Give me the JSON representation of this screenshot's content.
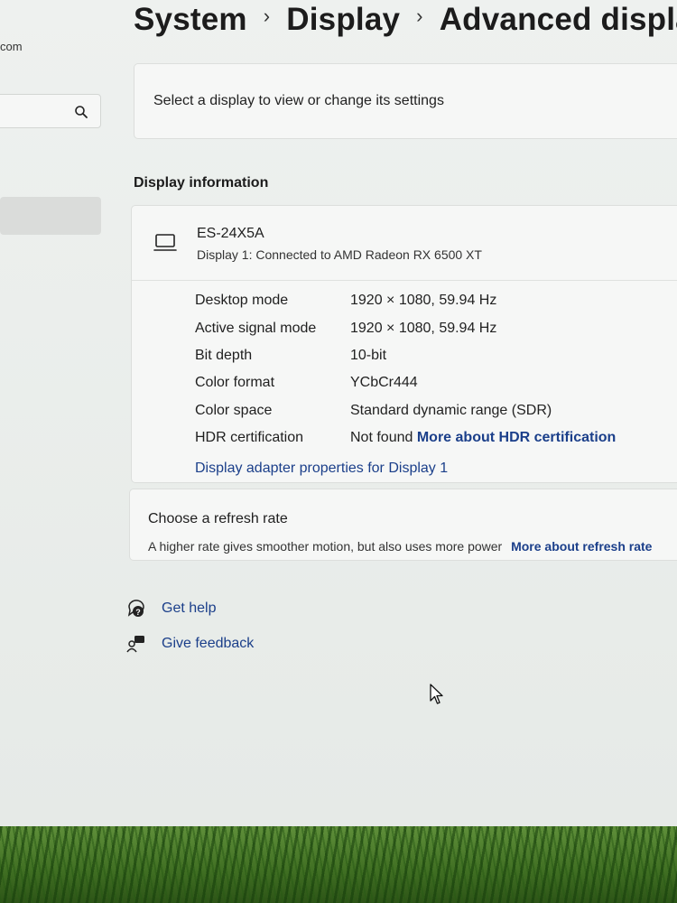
{
  "nav": {
    "account_text": "com",
    "search_icon": "search-icon"
  },
  "breadcrumb": {
    "items": [
      "System",
      "Display",
      "Advanced display"
    ],
    "separator": "›"
  },
  "select_display": {
    "label": "Select a display to view or change its settings"
  },
  "display_information": {
    "section_title": "Display information",
    "monitor_icon": "monitor-icon",
    "display_name": "ES-24X5A",
    "display_subtitle": "Display 1: Connected to AMD Radeon RX 6500 XT",
    "rows": [
      {
        "label": "Desktop mode",
        "value": "1920 × 1080, 59.94 Hz"
      },
      {
        "label": "Active signal mode",
        "value": "1920 × 1080, 59.94 Hz"
      },
      {
        "label": "Bit depth",
        "value": "10-bit"
      },
      {
        "label": "Color format",
        "value": "YCbCr444"
      },
      {
        "label": "Color space",
        "value": "Standard dynamic range (SDR)"
      },
      {
        "label": "HDR certification",
        "value": "Not found",
        "link": "More about HDR certification"
      }
    ],
    "adapter_link": "Display adapter properties for Display 1"
  },
  "refresh_rate": {
    "title": "Choose a refresh rate",
    "subtitle": "A higher rate gives smoother motion, but also uses more power",
    "link": "More about refresh rate"
  },
  "help": {
    "get_help": "Get help",
    "give_feedback": "Give feedback"
  },
  "colors": {
    "link": "#1b3f8a",
    "card": "#f6f7f6",
    "background": "#eef1ef"
  }
}
